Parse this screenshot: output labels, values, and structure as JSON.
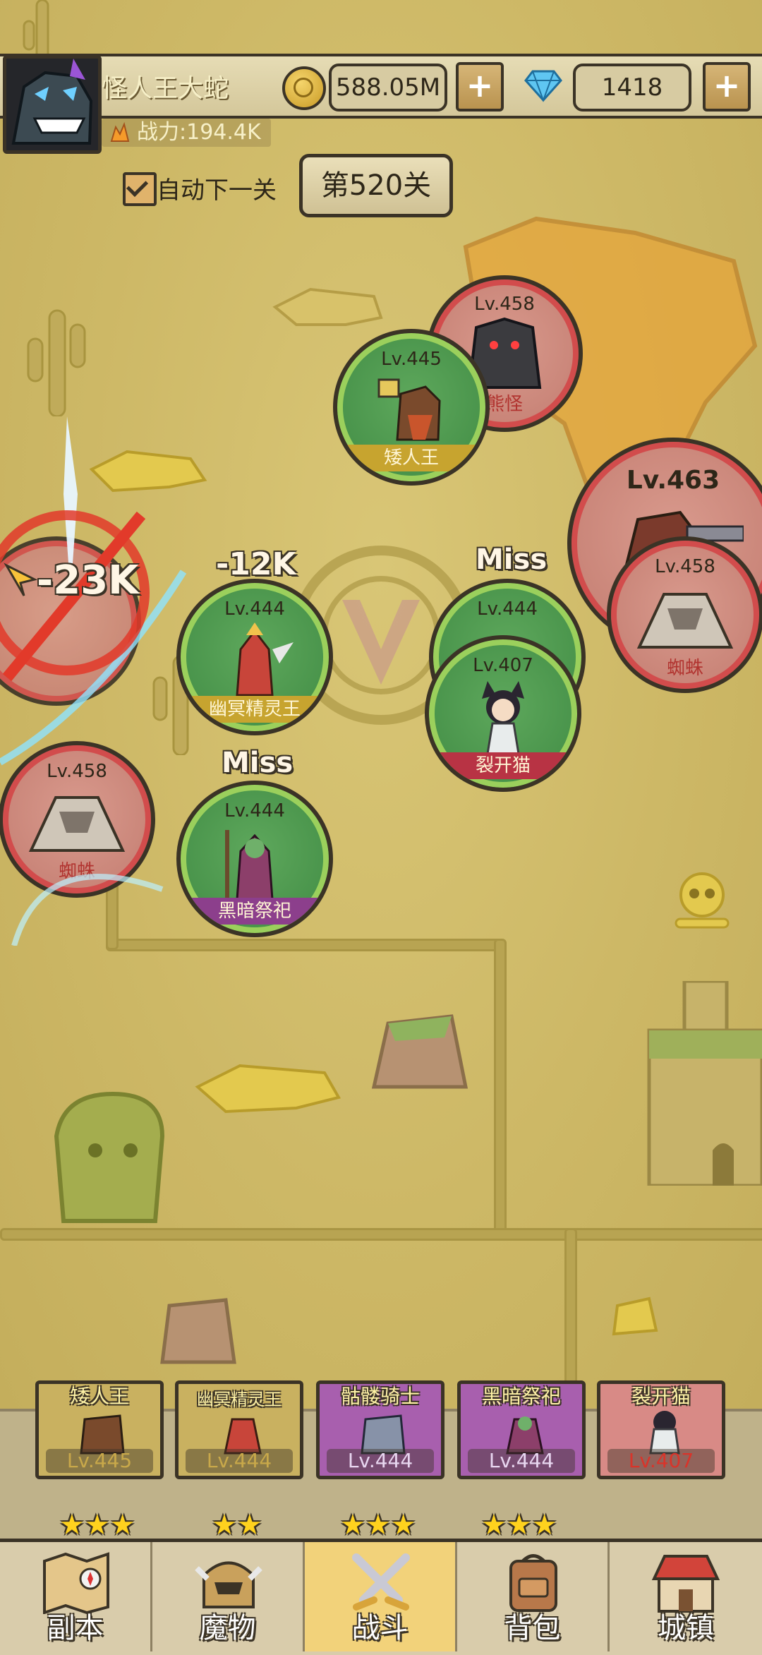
{
  "player": {
    "name": "怪人王大蛇",
    "power": "战力:194.4K"
  },
  "currency": {
    "gold": "588.05M",
    "gems": "1418",
    "plus": "+"
  },
  "stage": {
    "auto_label": "自动下一关",
    "auto_checked": true,
    "level": "第520关"
  },
  "units": [
    {
      "lv": "Lv.458",
      "name": "熊怪"
    },
    {
      "lv": "Lv.445",
      "name": "矮人王"
    },
    {
      "lv": "Lv.463",
      "name": ""
    },
    {
      "lv": "Lv.458",
      "name": "蜘蛛"
    },
    {
      "lv": "Lv.444",
      "name": "幽冥精灵王"
    },
    {
      "lv": "Lv.444",
      "name": ""
    },
    {
      "lv": "Lv.407",
      "name": "裂开猫"
    },
    {
      "lv": "Lv.458",
      "name": "蜘蛛"
    },
    {
      "lv": "Lv.444",
      "name": "黑暗祭祀"
    }
  ],
  "damage": {
    "big": "-23K",
    "small": "-12K",
    "miss1": "Miss",
    "miss2": "Miss"
  },
  "team": [
    {
      "name": "矮人王",
      "lv": "Lv.445",
      "stars": "★★★"
    },
    {
      "name": "幽冥精灵王",
      "lv": "Lv.444",
      "stars": "★★"
    },
    {
      "name": "骷髅骑士",
      "lv": "Lv.444",
      "stars": "★★★"
    },
    {
      "name": "黑暗祭祀",
      "lv": "Lv.444",
      "stars": "★★★"
    },
    {
      "name": "裂开猫",
      "lv": "Lv.407",
      "stars": ""
    }
  ],
  "nav": [
    {
      "label": "副本",
      "icon": "map-icon"
    },
    {
      "label": "魔物",
      "icon": "monster-helmet-icon"
    },
    {
      "label": "战斗",
      "icon": "crossed-swords-icon"
    },
    {
      "label": "背包",
      "icon": "backpack-icon"
    },
    {
      "label": "城镇",
      "icon": "town-house-icon"
    }
  ]
}
